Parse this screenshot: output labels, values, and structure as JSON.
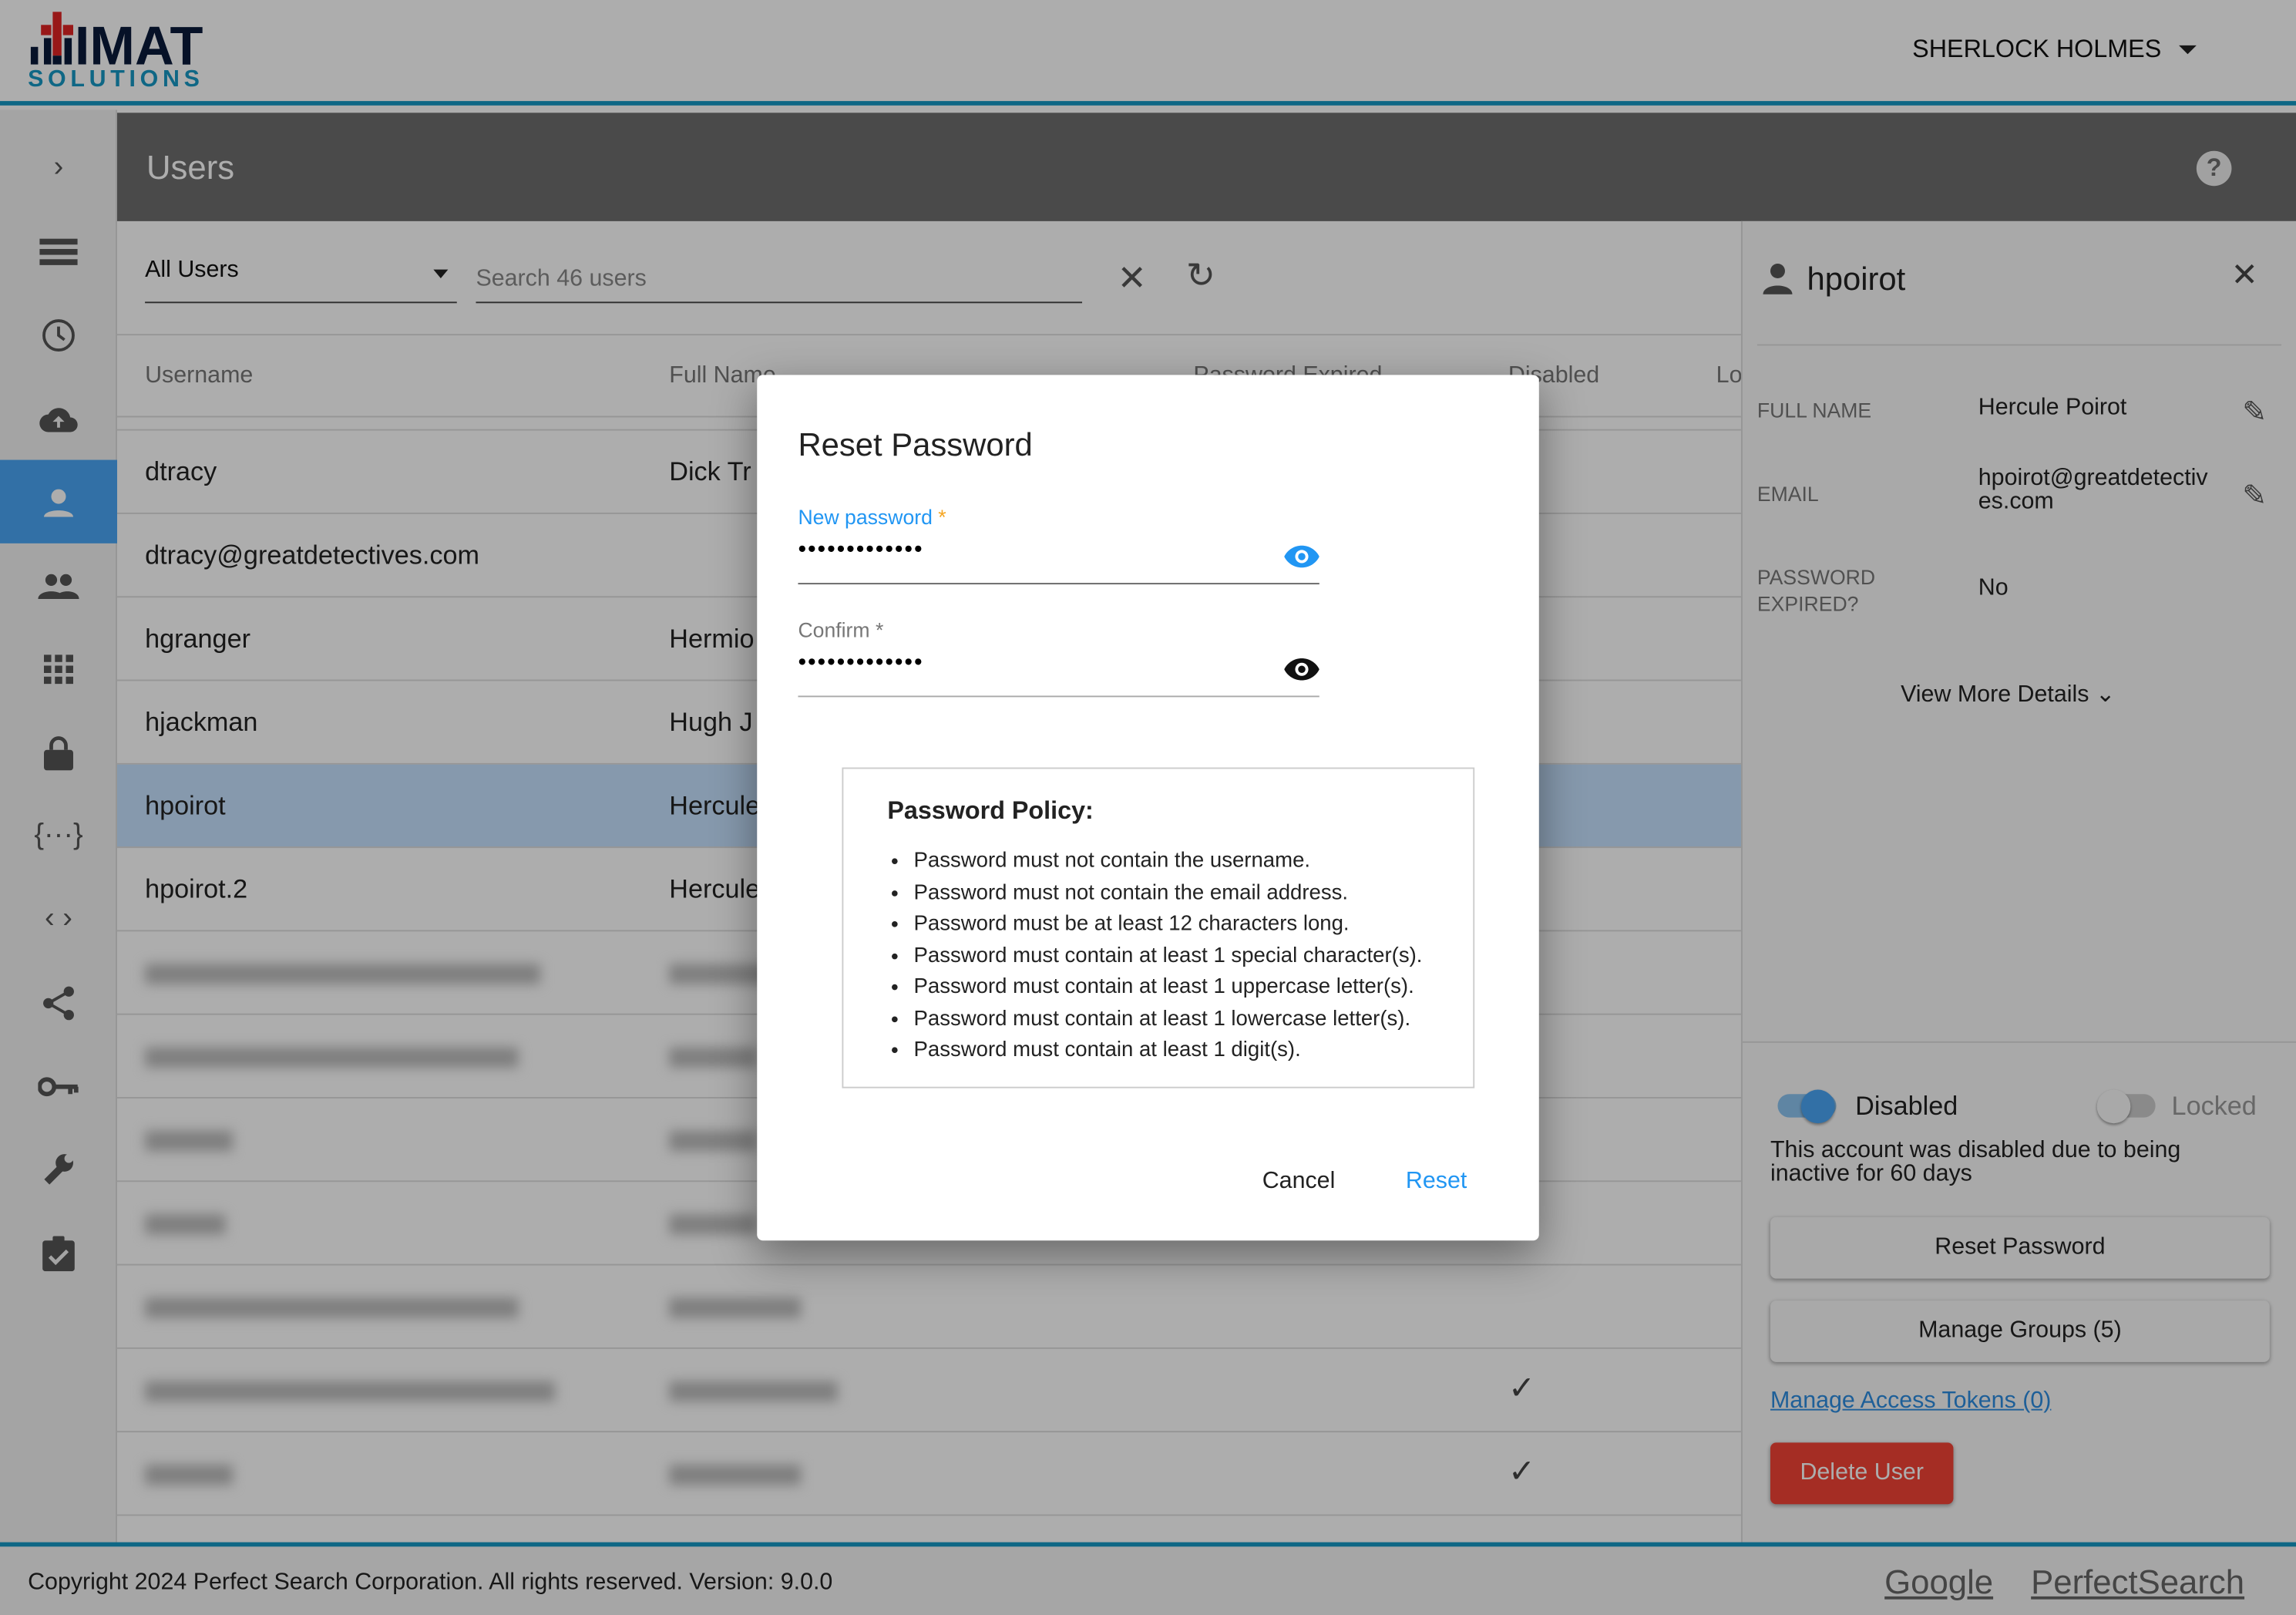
{
  "header": {
    "logo_text": "IMAT SOLUTIONS",
    "user": "SHERLOCK HOLMES"
  },
  "sidebar": {
    "items": [
      {
        "icon": "chevron-right-icon"
      },
      {
        "icon": "list-icon"
      },
      {
        "icon": "clock-icon"
      },
      {
        "icon": "cloud-upload-icon"
      },
      {
        "icon": "person-icon",
        "selected": true
      },
      {
        "icon": "group-icon"
      },
      {
        "icon": "apps-icon"
      },
      {
        "icon": "lock-icon"
      },
      {
        "icon": "json-braces-icon"
      },
      {
        "icon": "code-icon"
      },
      {
        "icon": "share-icon"
      },
      {
        "icon": "key-icon"
      },
      {
        "icon": "wrench-icon"
      },
      {
        "icon": "clipboard-check-icon"
      }
    ]
  },
  "page": {
    "title": "Users"
  },
  "toolbar": {
    "filter": "All Users",
    "search_placeholder": "Search 46 users"
  },
  "table": {
    "columns": [
      "Username",
      "Full Name",
      "Password Expired",
      "Disabled",
      "Lo"
    ],
    "rows": [
      {
        "username": "dtracy",
        "full_name": "Dick Tr"
      },
      {
        "username": "dtracy@greatdetectives.com",
        "full_name": ""
      },
      {
        "username": "hgranger",
        "full_name": "Hermio"
      },
      {
        "username": "hjackman",
        "full_name": "Hugh J"
      },
      {
        "username": "hpoirot",
        "full_name": "Hercule",
        "selected": true
      },
      {
        "username": "hpoirot.2",
        "full_name": "Hercule"
      }
    ]
  },
  "panel": {
    "username": "hpoirot",
    "full_name_label": "FULL NAME",
    "full_name": "Hercule Poirot",
    "email_label": "EMAIL",
    "email": "hpoirot@greatdetectives.com",
    "pw_expired_label": "PASSWORD EXPIRED?",
    "pw_expired": "No",
    "more": "View More Details",
    "disabled_label": "Disabled",
    "disabled": true,
    "locked_label": "Locked",
    "locked": false,
    "disabled_note": "This account was disabled due to being inactive for 60 days",
    "reset_btn": "Reset Password",
    "groups_btn": "Manage Groups (5)",
    "tokens_link": "Manage Access Tokens (0)",
    "delete_btn": "Delete User"
  },
  "footer": {
    "copyright": "Copyright 2024 Perfect Search Corporation. All rights reserved. Version: 9.0.0",
    "link1": "Google",
    "link2": "PerfectSearch"
  },
  "modal": {
    "title": "Reset Password",
    "new_label": "New password",
    "new_value": "•••••••••••••",
    "confirm_label": "Confirm",
    "confirm_value": "•••••••••••••",
    "required_mark": "*",
    "policy_title": "Password Policy:",
    "policy": [
      "Password must not contain the username.",
      "Password must not contain the email address.",
      "Password must be at least 12 characters long.",
      "Password must contain at least 1 special character(s).",
      "Password must contain at least 1 uppercase letter(s).",
      "Password must contain at least 1 lowercase letter(s).",
      "Password must contain at least 1 digit(s)."
    ],
    "cancel": "Cancel",
    "reset": "Reset"
  },
  "colors": {
    "accent": "#2196f3",
    "brand_teal": "#1698c4",
    "danger": "#d32f2f",
    "logo_red": "#c62828",
    "logo_navy": "#0a1a3a"
  }
}
